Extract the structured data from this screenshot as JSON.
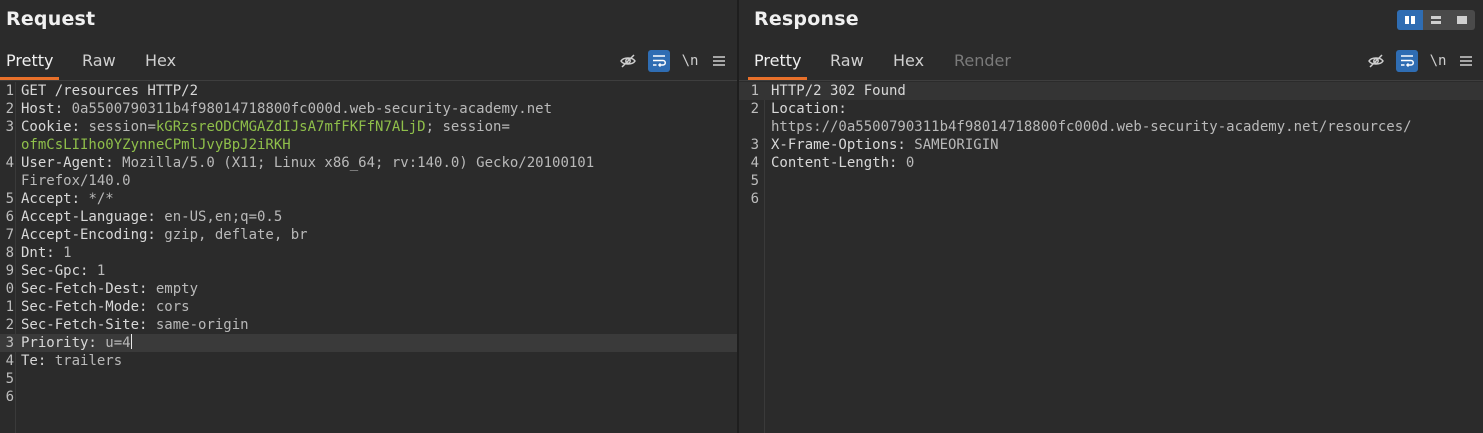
{
  "request": {
    "title": "Request",
    "tabs": [
      "Pretty",
      "Raw",
      "Hex"
    ],
    "active_tab": "Pretty",
    "tools": {
      "hide_icon": "eye-off-icon",
      "wrap_icon": "wrap-icon",
      "newline_label": "\\n",
      "menu_icon": "menu-icon"
    },
    "lines": [
      {
        "num": "1",
        "name": "GET /resources HTTP/2",
        "value": ""
      },
      {
        "num": "2",
        "name": "Host:",
        "value": " 0a5500790311b4f98014718800fc000d.web-security-academy.net"
      },
      {
        "num": "3",
        "name": "Cookie:",
        "value": " session=",
        "green": "kGRzsreODCMGAZdIJsA7mfFKFfN7ALjD",
        "tail": "; session="
      },
      {
        "num": "",
        "name": "",
        "value": "",
        "green": "ofmCsLIIho0YZynneCPmlJvyBpJ2iRKH"
      },
      {
        "num": "4",
        "name": "User-Agent:",
        "value": " Mozilla/5.0 (X11; Linux x86_64; rv:140.0) Gecko/20100101"
      },
      {
        "num": "",
        "name": "",
        "value": "Firefox/140.0"
      },
      {
        "num": "5",
        "name": "Accept:",
        "value": " */*"
      },
      {
        "num": "6",
        "name": "Accept-Language:",
        "value": " en-US,en;q=0.5"
      },
      {
        "num": "7",
        "name": "Accept-Encoding:",
        "value": " gzip, deflate, br"
      },
      {
        "num": "8",
        "name": "Dnt:",
        "value": " 1"
      },
      {
        "num": "9",
        "name": "Sec-Gpc:",
        "value": " 1"
      },
      {
        "num": "0",
        "name": "Sec-Fetch-Dest:",
        "value": " empty"
      },
      {
        "num": "1",
        "name": "Sec-Fetch-Mode:",
        "value": " cors"
      },
      {
        "num": "2",
        "name": "Sec-Fetch-Site:",
        "value": " same-origin"
      },
      {
        "num": "3",
        "name": "Priority:",
        "value": " u=4",
        "caret": true,
        "highlight": true
      },
      {
        "num": "4",
        "name": "Te:",
        "value": " trailers"
      },
      {
        "num": "5",
        "name": "",
        "value": ""
      },
      {
        "num": "6",
        "name": "",
        "value": ""
      }
    ]
  },
  "response": {
    "title": "Response",
    "tabs": [
      "Pretty",
      "Raw",
      "Hex",
      "Render"
    ],
    "active_tab": "Pretty",
    "tools": {
      "hide_icon": "eye-off-icon",
      "wrap_icon": "wrap-icon",
      "newline_label": "\\n",
      "menu_icon": "menu-icon"
    },
    "lines": [
      {
        "num": "1",
        "name": "HTTP/2 302 Found",
        "value": "",
        "highlight": true
      },
      {
        "num": "2",
        "name": "Location:",
        "value": ""
      },
      {
        "num": "",
        "name": "",
        "value": "https://0a5500790311b4f98014718800fc000d.web-security-academy.net/resources/"
      },
      {
        "num": "3",
        "name": "X-Frame-Options:",
        "value": " SAMEORIGIN"
      },
      {
        "num": "4",
        "name": "Content-Length:",
        "value": " 0"
      },
      {
        "num": "5",
        "name": "",
        "value": ""
      },
      {
        "num": "6",
        "name": "",
        "value": ""
      }
    ]
  },
  "layout_toggle": {
    "options": [
      "side-by-side",
      "stacked",
      "single"
    ],
    "active": "side-by-side"
  },
  "colors": {
    "accent_tab": "#e8702a",
    "active_tool": "#2f6db3",
    "cookie_value": "#8fbf4a"
  }
}
